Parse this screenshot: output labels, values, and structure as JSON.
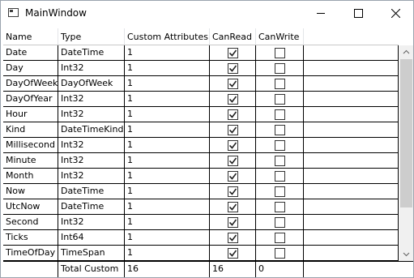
{
  "window": {
    "title": "MainWindow"
  },
  "grid": {
    "headers": [
      "Name",
      "Type",
      "Custom Attributes",
      "CanRead",
      "CanWrite"
    ],
    "rows": [
      {
        "name": "Date",
        "type": "DateTime",
        "custom": "1",
        "can_read": true,
        "can_write": false
      },
      {
        "name": "Day",
        "type": "Int32",
        "custom": "1",
        "can_read": true,
        "can_write": false
      },
      {
        "name": "DayOfWeek",
        "type": "DayOfWeek",
        "custom": "1",
        "can_read": true,
        "can_write": false
      },
      {
        "name": "DayOfYear",
        "type": "Int32",
        "custom": "1",
        "can_read": true,
        "can_write": false
      },
      {
        "name": "Hour",
        "type": "Int32",
        "custom": "1",
        "can_read": true,
        "can_write": false
      },
      {
        "name": "Kind",
        "type": "DateTimeKind",
        "custom": "1",
        "can_read": true,
        "can_write": false
      },
      {
        "name": "Millisecond",
        "type": "Int32",
        "custom": "1",
        "can_read": true,
        "can_write": false
      },
      {
        "name": "Minute",
        "type": "Int32",
        "custom": "1",
        "can_read": true,
        "can_write": false
      },
      {
        "name": "Month",
        "type": "Int32",
        "custom": "1",
        "can_read": true,
        "can_write": false
      },
      {
        "name": "Now",
        "type": "DateTime",
        "custom": "1",
        "can_read": true,
        "can_write": false
      },
      {
        "name": "UtcNow",
        "type": "DateTime",
        "custom": "1",
        "can_read": true,
        "can_write": false
      },
      {
        "name": "Second",
        "type": "Int32",
        "custom": "1",
        "can_read": true,
        "can_write": false
      },
      {
        "name": "Ticks",
        "type": "Int64",
        "custom": "1",
        "can_read": true,
        "can_write": false
      },
      {
        "name": "TimeOfDay",
        "type": "TimeSpan",
        "custom": "1",
        "can_read": true,
        "can_write": false
      }
    ],
    "footer": {
      "label": "Total Custom",
      "custom_total": "16",
      "can_read_total": "16",
      "can_write_total": "0"
    }
  },
  "icons": {
    "minimize": "minimize-icon",
    "maximize": "maximize-icon",
    "close": "close-icon",
    "check": "checkmark-icon"
  }
}
